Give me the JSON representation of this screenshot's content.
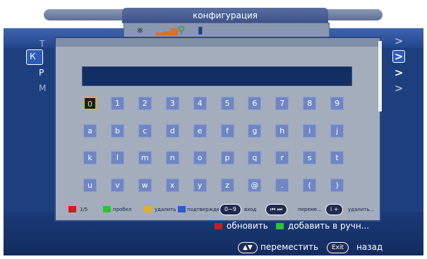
{
  "window": {
    "title": "конфигурация"
  },
  "status_icons": [
    "antenna-icon",
    "signal-bars-icon",
    "network-icon",
    "battery-icon"
  ],
  "background_menu": {
    "left_letters": [
      "Т",
      "К",
      "Р",
      "М"
    ],
    "right_chevrons": [
      ">",
      ">",
      ">",
      ">"
    ]
  },
  "keyboard": {
    "input_value": "",
    "rows": [
      [
        "0",
        "1",
        "2",
        "3",
        "4",
        "5",
        "6",
        "7",
        "8",
        "9"
      ],
      [
        "a",
        "b",
        "c",
        "d",
        "e",
        "f",
        "g",
        "h",
        "i",
        "j"
      ],
      [
        "k",
        "l",
        "m",
        "n",
        "o",
        "p",
        "q",
        "r",
        "s",
        "t"
      ],
      [
        "u",
        "v",
        "w",
        "x",
        "y",
        "z",
        "@",
        ".",
        "(",
        ")"
      ]
    ],
    "selected_key": "0"
  },
  "legend": {
    "red_label": "1/5",
    "green_label": "пробел",
    "yellow_label": "удалить",
    "blue_label": "подтвержде...",
    "digits_pill": "0~9",
    "digits_label": "вход",
    "skip_pill": "⏮ ⏭",
    "skip_label": "переме...",
    "info_pill": "i +",
    "info_label": "удалить..."
  },
  "bottom_bar": {
    "red_label": "обновить",
    "green_label": "добавить в ручн...",
    "nav_pill": "▲▼",
    "nav_label": "переместить",
    "exit_pill": "Exit",
    "exit_label": "назад"
  },
  "colors": {
    "red": "#cc1c1c",
    "green": "#2bc62b",
    "yellow": "#e0b020",
    "blue": "#2a5ad0",
    "key": "#6f86c2",
    "dialog": "#a3adbb",
    "input": "#132e63"
  }
}
